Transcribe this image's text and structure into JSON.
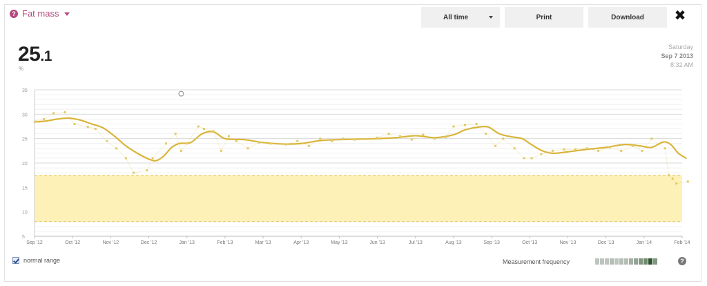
{
  "header": {
    "help_icon": "?",
    "metric_title": "Fat mass",
    "range_label": "All time",
    "print_label": "Print",
    "download_label": "Download",
    "close_icon": "✖"
  },
  "current": {
    "value_int": "25",
    "value_dec": ".1",
    "unit": "%",
    "day": "Saturday",
    "date": "Sep 7 2013",
    "time": "8:32 AM"
  },
  "footer": {
    "normal_range_label": "normal range",
    "frequency_label": "Measurement frequency",
    "frequency_levels": [
      0.15,
      0.15,
      0.15,
      0.2,
      0.15,
      0.2,
      0.2,
      0.3,
      0.4,
      0.5,
      0.6,
      1.0,
      0.5
    ],
    "help_icon": "?"
  },
  "colors": {
    "trend": "#d9b43a",
    "points": "#e3c965",
    "range_fill": "#fdf1b8",
    "range_border": "#e0c25a",
    "accent": "#b44a7e"
  },
  "chart_data": {
    "type": "line",
    "title": "",
    "xlabel": "",
    "ylabel": "",
    "ylim": [
      5,
      35
    ],
    "yticks": [
      5,
      10,
      15,
      20,
      25,
      30,
      35
    ],
    "x_months": [
      "Sep '12",
      "Oct '12",
      "Nov '12",
      "Dec '12",
      "Jan '13",
      "Feb '13",
      "Mar '13",
      "Apr '13",
      "May '13",
      "Jun '13",
      "Jul '13",
      "Aug '13",
      "Sep '13",
      "Oct '13",
      "Nov '13",
      "Dec '13",
      "Jan '14",
      "Feb '14"
    ],
    "normal_range": [
      8,
      17.5
    ],
    "series": [
      {
        "style": "trend",
        "x": [
          0,
          0.3,
          0.6,
          0.9,
          1.2,
          1.5,
          1.8,
          2.1,
          2.4,
          2.7,
          3.0,
          3.2,
          3.4,
          3.6,
          3.8,
          4.1,
          4.4,
          4.7,
          5.0,
          5.5,
          6.0,
          6.5,
          7.0,
          7.5,
          8.0,
          8.5,
          9.0,
          9.5,
          10.0,
          10.5,
          11.0,
          11.3,
          11.6,
          11.9,
          12.2,
          12.5,
          12.8,
          13.0,
          13.3,
          13.6,
          14.0,
          14.5,
          15.0,
          15.5,
          15.9,
          16.2,
          16.5,
          16.7,
          16.9,
          17.1
        ],
        "y": [
          28.4,
          28.6,
          29.0,
          29.2,
          28.8,
          28.0,
          27.2,
          25.5,
          23.5,
          22.0,
          20.8,
          20.5,
          21.5,
          23.2,
          24.0,
          24.2,
          26.0,
          26.4,
          25.0,
          24.8,
          24.2,
          23.9,
          24.0,
          24.6,
          24.8,
          24.9,
          25.0,
          25.2,
          25.6,
          25.2,
          25.8,
          26.8,
          27.3,
          27.4,
          26.0,
          25.4,
          25.0,
          24.0,
          22.6,
          22.0,
          22.3,
          22.8,
          23.2,
          23.8,
          23.5,
          23.2,
          24.3,
          23.8,
          22.0,
          21.0
        ],
        "values_note": ""
      },
      {
        "style": "points",
        "x": [
          0.05,
          0.25,
          0.5,
          0.8,
          1.05,
          1.4,
          1.6,
          1.9,
          2.15,
          2.4,
          2.6,
          2.95,
          3.1,
          3.45,
          3.7,
          3.85,
          4.0,
          4.3,
          4.45,
          4.7,
          4.9,
          5.1,
          5.3,
          5.6,
          5.9,
          6.2,
          6.6,
          6.9,
          7.2,
          7.5,
          7.8,
          8.1,
          8.4,
          8.7,
          9.0,
          9.3,
          9.6,
          9.9,
          10.2,
          10.5,
          10.8,
          11.0,
          11.3,
          11.6,
          11.85,
          12.1,
          12.3,
          12.6,
          12.85,
          13.05,
          13.3,
          13.6,
          13.9,
          14.2,
          14.5,
          14.8,
          15.1,
          15.4,
          15.7,
          15.95,
          16.2,
          16.55,
          16.65,
          16.75,
          16.85,
          17.15
        ],
        "y": [
          28.5,
          29.0,
          30.2,
          30.4,
          28.0,
          27.4,
          27.0,
          24.5,
          23.0,
          21.0,
          18.0,
          18.5,
          21.0,
          24.0,
          26.0,
          22.5,
          24.0,
          27.5,
          27.0,
          26.5,
          22.5,
          25.5,
          24.5,
          23.0,
          24.2,
          24.0,
          23.8,
          24.5,
          23.5,
          25.0,
          24.5,
          25.0,
          24.8,
          24.9,
          25.2,
          26.0,
          25.5,
          24.8,
          25.8,
          25.0,
          25.3,
          27.5,
          27.8,
          28.0,
          26.0,
          23.5,
          25.0,
          23.0,
          21.0,
          21.0,
          21.8,
          22.5,
          22.8,
          22.8,
          23.0,
          22.5,
          23.2,
          22.5,
          23.5,
          22.5,
          25.0,
          23.0,
          17.5,
          16.8,
          15.8,
          16.2
        ]
      }
    ],
    "annotation_marker": {
      "x": 3.85,
      "y": 34.2
    }
  }
}
